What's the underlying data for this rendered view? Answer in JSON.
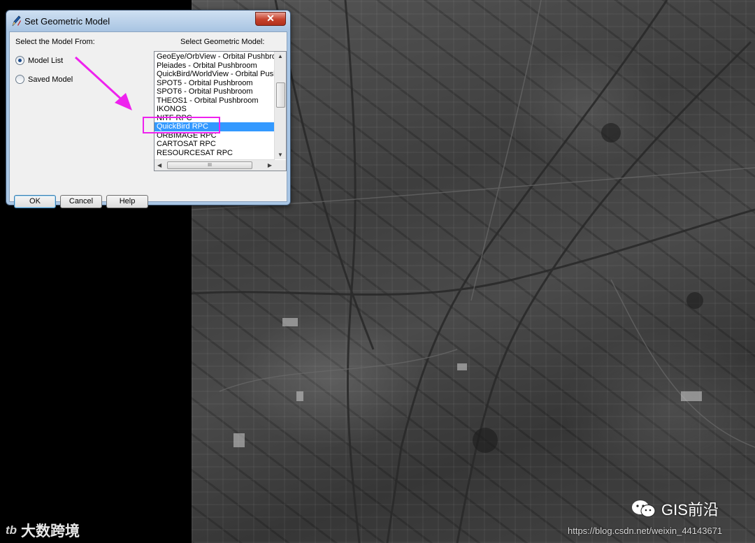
{
  "dialog": {
    "title": "Set Geometric Model",
    "close_glyph": "✕",
    "select_from_label": "Select the Model From:",
    "select_model_label": "Select Geometric Model:",
    "radio_options": [
      {
        "label": "Model List",
        "checked": true
      },
      {
        "label": "Saved Model",
        "checked": false
      }
    ],
    "models": [
      "GeoEye/OrbView - Orbital Pushbroom",
      "Pleiades - Orbital Pushbroom",
      "QuickBird/WorldView - Orbital Pushbroom",
      "SPOT5 - Orbital Pushbroom",
      "SPOT6 - Orbital Pushbroom",
      "THEOS1 - Orbital Pushbroom",
      "IKONOS",
      "NITF RPC",
      "QuickBird RPC",
      "ORBIMAGE RPC",
      "CARTOSAT RPC",
      "RESOURCESAT RPC"
    ],
    "selected_model": "QuickBird RPC",
    "hscroll_grip": "III",
    "buttons": {
      "ok": "OK",
      "cancel": "Cancel",
      "help": "Help"
    }
  },
  "annotation": {
    "color": "#ee22ee"
  },
  "watermarks": {
    "left_logo": "tb",
    "left_text": "大数跨境",
    "gis_text": "GIS前沿",
    "url": "https://blog.csdn.net/weixin_44143671"
  },
  "icons": {
    "title_icon": "pencil-icon",
    "close": "close-icon",
    "wechat": "wechat-icon"
  }
}
